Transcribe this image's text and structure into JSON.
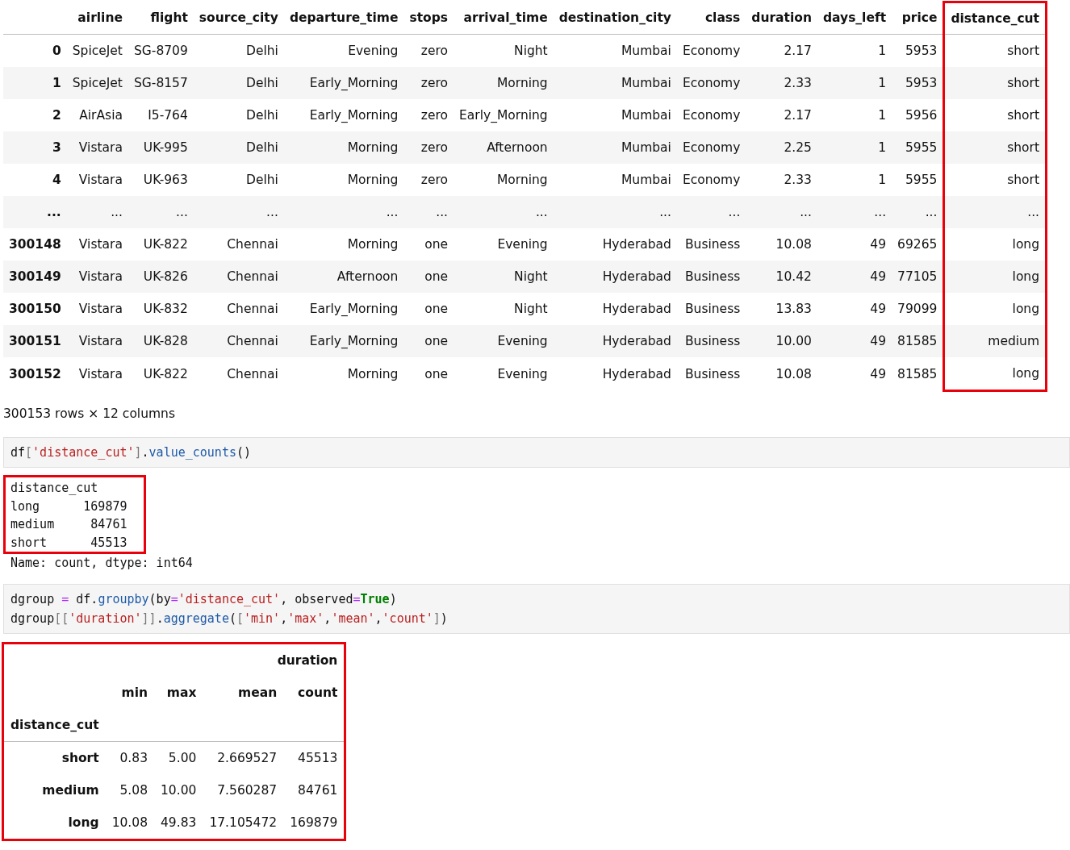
{
  "dataframe": {
    "columns": [
      {
        "label": "airline",
        "highlighted": false
      },
      {
        "label": "flight",
        "highlighted": false
      },
      {
        "label": "source_city",
        "highlighted": false
      },
      {
        "label": "departure_time",
        "highlighted": false
      },
      {
        "label": "stops",
        "highlighted": false
      },
      {
        "label": "arrival_time",
        "highlighted": false
      },
      {
        "label": "destination_city",
        "highlighted": false
      },
      {
        "label": "class",
        "highlighted": false
      },
      {
        "label": "duration",
        "highlighted": false
      },
      {
        "label": "days_left",
        "highlighted": false
      },
      {
        "label": "price",
        "highlighted": false
      },
      {
        "label": "distance_cut",
        "highlighted": true
      }
    ],
    "rows": [
      {
        "index": "0",
        "cells": [
          "SpiceJet",
          "SG-8709",
          "Delhi",
          "Evening",
          "zero",
          "Night",
          "Mumbai",
          "Economy",
          "2.17",
          "1",
          "5953",
          "short"
        ]
      },
      {
        "index": "1",
        "cells": [
          "SpiceJet",
          "SG-8157",
          "Delhi",
          "Early_Morning",
          "zero",
          "Morning",
          "Mumbai",
          "Economy",
          "2.33",
          "1",
          "5953",
          "short"
        ]
      },
      {
        "index": "2",
        "cells": [
          "AirAsia",
          "I5-764",
          "Delhi",
          "Early_Morning",
          "zero",
          "Early_Morning",
          "Mumbai",
          "Economy",
          "2.17",
          "1",
          "5956",
          "short"
        ]
      },
      {
        "index": "3",
        "cells": [
          "Vistara",
          "UK-995",
          "Delhi",
          "Morning",
          "zero",
          "Afternoon",
          "Mumbai",
          "Economy",
          "2.25",
          "1",
          "5955",
          "short"
        ]
      },
      {
        "index": "4",
        "cells": [
          "Vistara",
          "UK-963",
          "Delhi",
          "Morning",
          "zero",
          "Morning",
          "Mumbai",
          "Economy",
          "2.33",
          "1",
          "5955",
          "short"
        ]
      },
      {
        "index": "...",
        "cells": [
          "...",
          "...",
          "...",
          "...",
          "...",
          "...",
          "...",
          "...",
          "...",
          "...",
          "...",
          "..."
        ]
      },
      {
        "index": "300148",
        "cells": [
          "Vistara",
          "UK-822",
          "Chennai",
          "Morning",
          "one",
          "Evening",
          "Hyderabad",
          "Business",
          "10.08",
          "49",
          "69265",
          "long"
        ]
      },
      {
        "index": "300149",
        "cells": [
          "Vistara",
          "UK-826",
          "Chennai",
          "Afternoon",
          "one",
          "Night",
          "Hyderabad",
          "Business",
          "10.42",
          "49",
          "77105",
          "long"
        ]
      },
      {
        "index": "300150",
        "cells": [
          "Vistara",
          "UK-832",
          "Chennai",
          "Early_Morning",
          "one",
          "Night",
          "Hyderabad",
          "Business",
          "13.83",
          "49",
          "79099",
          "long"
        ]
      },
      {
        "index": "300151",
        "cells": [
          "Vistara",
          "UK-828",
          "Chennai",
          "Early_Morning",
          "one",
          "Evening",
          "Hyderabad",
          "Business",
          "10.00",
          "49",
          "81585",
          "medium"
        ]
      },
      {
        "index": "300152",
        "cells": [
          "Vistara",
          "UK-822",
          "Chennai",
          "Morning",
          "one",
          "Evening",
          "Hyderabad",
          "Business",
          "10.08",
          "49",
          "81585",
          "long"
        ]
      }
    ],
    "summary": "300153 rows × 12 columns"
  },
  "cells": [
    {
      "kind": "code",
      "lines": [
        [
          {
            "kind": "name",
            "text": "df"
          },
          {
            "kind": "punct",
            "text": "["
          },
          {
            "kind": "string",
            "text": "'distance_cut'"
          },
          {
            "kind": "punct",
            "text": "]"
          },
          {
            "kind": "name",
            "text": "."
          },
          {
            "kind": "func",
            "text": "value_counts"
          },
          {
            "kind": "name",
            "text": "()"
          }
        ]
      ]
    },
    {
      "kind": "text",
      "highlighted": true,
      "boxed": [
        "distance_cut",
        "long      169879",
        "medium     84761",
        "short      45513"
      ],
      "lines": [
        "Name: count, dtype: int64"
      ]
    },
    {
      "kind": "code",
      "lines": [
        [
          {
            "kind": "name",
            "text": "dgroup "
          },
          {
            "kind": "op",
            "text": "="
          },
          {
            "kind": "name",
            "text": " df."
          },
          {
            "kind": "func",
            "text": "groupby"
          },
          {
            "kind": "name",
            "text": "(by"
          },
          {
            "kind": "op",
            "text": "="
          },
          {
            "kind": "string",
            "text": "'distance_cut'"
          },
          {
            "kind": "name",
            "text": ", observed"
          },
          {
            "kind": "op",
            "text": "="
          },
          {
            "kind": "keyword",
            "text": "True"
          },
          {
            "kind": "name",
            "text": ")"
          }
        ],
        [
          {
            "kind": "name",
            "text": "dgroup"
          },
          {
            "kind": "punct",
            "text": "[["
          },
          {
            "kind": "string",
            "text": "'duration'"
          },
          {
            "kind": "punct",
            "text": "]]"
          },
          {
            "kind": "name",
            "text": "."
          },
          {
            "kind": "func",
            "text": "aggregate"
          },
          {
            "kind": "name",
            "text": "("
          },
          {
            "kind": "punct",
            "text": "["
          },
          {
            "kind": "string",
            "text": "'min'"
          },
          {
            "kind": "name",
            "text": ","
          },
          {
            "kind": "string",
            "text": "'max'"
          },
          {
            "kind": "name",
            "text": ","
          },
          {
            "kind": "string",
            "text": "'mean'"
          },
          {
            "kind": "name",
            "text": ","
          },
          {
            "kind": "string",
            "text": "'count'"
          },
          {
            "kind": "punct",
            "text": "]"
          },
          {
            "kind": "name",
            "text": ")"
          }
        ]
      ]
    },
    {
      "kind": "table",
      "highlighted": true,
      "column_group": "duration",
      "columns": [
        "min",
        "max",
        "mean",
        "count"
      ],
      "index_name": "distance_cut",
      "rows": [
        {
          "index": "short",
          "cells": [
            "0.83",
            "5.00",
            "2.669527",
            "45513"
          ]
        },
        {
          "index": "medium",
          "cells": [
            "5.08",
            "10.00",
            "7.560287",
            "84761"
          ]
        },
        {
          "index": "long",
          "cells": [
            "10.08",
            "49.83",
            "17.105472",
            "169879"
          ]
        }
      ]
    }
  ]
}
